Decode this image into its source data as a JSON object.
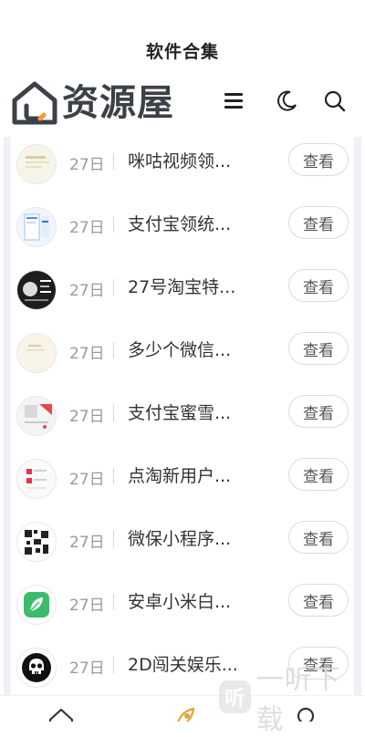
{
  "header": {
    "title": "软件合集",
    "logo_text": "资源屋",
    "icons": [
      "menu-icon",
      "moon-icon",
      "search-icon"
    ]
  },
  "items": [
    {
      "date": "27日",
      "title": "咪咕视频领...",
      "button": "查看",
      "thumb": "migu-thumb"
    },
    {
      "date": "27日",
      "title": "支付宝领统...",
      "button": "查看",
      "thumb": "alipay-thumb"
    },
    {
      "date": "27日",
      "title": "27号淘宝特...",
      "button": "查看",
      "thumb": "taobao-thumb"
    },
    {
      "date": "27日",
      "title": "多少个微信...",
      "button": "查看",
      "thumb": "wechat-thumb"
    },
    {
      "date": "27日",
      "title": "支付宝蜜雪...",
      "button": "查看",
      "thumb": "alipay-mixue-thumb"
    },
    {
      "date": "27日",
      "title": "点淘新用户...",
      "button": "查看",
      "thumb": "diantao-thumb"
    },
    {
      "date": "27日",
      "title": "微保小程序...",
      "button": "查看",
      "thumb": "weibao-thumb"
    },
    {
      "date": "27日",
      "title": "安卓小米白...",
      "button": "查看",
      "thumb": "xiaomi-leaf-thumb"
    },
    {
      "date": "27日",
      "title": "2D闯关娱乐...",
      "button": "查看",
      "thumb": "skull-game-thumb"
    }
  ],
  "bottom_nav": [
    "home-icon",
    "rocket-icon",
    "user-icon"
  ],
  "watermark": {
    "badge": "听",
    "text": "一听下载"
  },
  "colors": {
    "accent": "#e8a23a",
    "logo": "#3c4047",
    "bg": "#ffffff"
  }
}
